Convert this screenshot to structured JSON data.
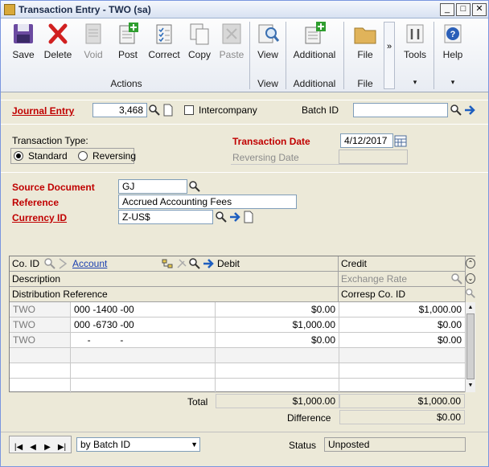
{
  "window": {
    "title": "Transaction Entry  -  TWO (sa)"
  },
  "ribbon": {
    "buttons": [
      {
        "label": "Save",
        "icon": "save-icon"
      },
      {
        "label": "Delete",
        "icon": "delete-icon"
      },
      {
        "label": "Void",
        "icon": "void-icon"
      },
      {
        "label": "Post",
        "icon": "post-icon"
      },
      {
        "label": "Correct",
        "icon": "correct-icon"
      },
      {
        "label": "Copy",
        "icon": "copy-icon"
      },
      {
        "label": "Paste",
        "icon": "paste-icon"
      },
      {
        "label": "View",
        "icon": "view-icon"
      },
      {
        "label": "Additional",
        "icon": "additional-icon"
      },
      {
        "label": "File",
        "icon": "file-icon"
      },
      {
        "label": "Tools",
        "icon": "tools-icon"
      },
      {
        "label": "Help",
        "icon": "help-icon"
      }
    ],
    "groups": {
      "actions": "Actions",
      "view": "View",
      "additional": "Additional",
      "file": "File"
    },
    "more": "»"
  },
  "header": {
    "journal_entry_label": "Journal Entry",
    "journal_entry_value": "3,468",
    "intercompany_label": "Intercompany",
    "batch_id_label": "Batch ID",
    "batch_id_value": "",
    "transaction_type_label": "Transaction Type:",
    "standard_label": "Standard",
    "reversing_label": "Reversing",
    "transaction_date_label": "Transaction Date",
    "transaction_date_value": "4/12/2017",
    "reversing_date_label": "Reversing Date",
    "source_document_label": "Source Document",
    "source_document_value": "GJ",
    "reference_label": "Reference",
    "reference_value": "Accrued Accounting Fees",
    "currency_id_label": "Currency ID",
    "currency_id_value": "Z-US$"
  },
  "grid": {
    "headers": {
      "co_id": "Co. ID",
      "account": "Account",
      "debit": "Debit",
      "credit": "Credit",
      "description": "Description",
      "exchange_rate": "Exchange Rate",
      "distribution_reference": "Distribution Reference",
      "corresp_co_id": "Corresp Co. ID"
    },
    "rows": [
      {
        "co_id": "TWO",
        "account": "000 -1400 -00",
        "debit": "$0.00",
        "credit": "$1,000.00"
      },
      {
        "co_id": "TWO",
        "account": "000 -6730 -00",
        "debit": "$1,000.00",
        "credit": "$0.00"
      },
      {
        "co_id": "TWO",
        "account": "     -           -",
        "debit": "$0.00",
        "credit": "$0.00"
      }
    ]
  },
  "totals": {
    "total_label": "Total",
    "total_debit": "$1,000.00",
    "total_credit": "$1,000.00",
    "difference_label": "Difference",
    "difference_value": "$0.00"
  },
  "footer": {
    "sort_value": "by Batch ID",
    "status_label": "Status",
    "status_value": "Unposted"
  }
}
